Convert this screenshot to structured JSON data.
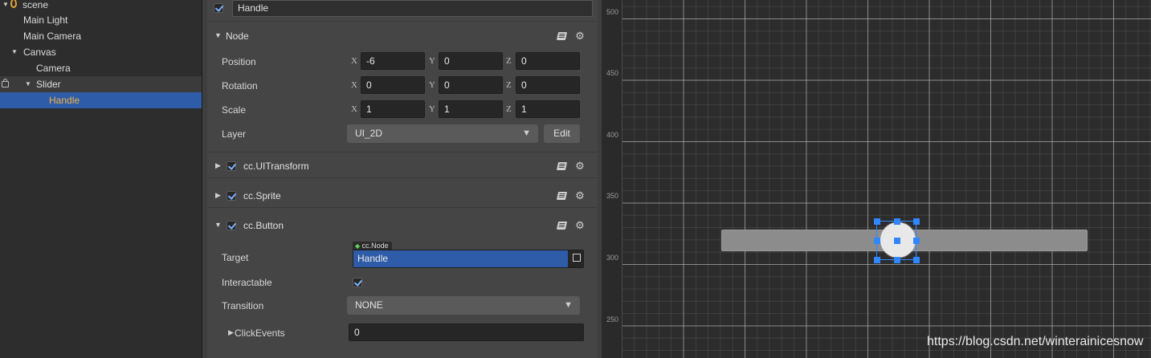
{
  "hierarchy": {
    "items": [
      {
        "label": "scene",
        "depth": 0,
        "expanded": true
      },
      {
        "label": "Main Light",
        "depth": 1
      },
      {
        "label": "Main Camera",
        "depth": 1
      },
      {
        "label": "Canvas",
        "depth": 1,
        "expanded": true
      },
      {
        "label": "Camera",
        "depth": 2
      },
      {
        "label": "Slider",
        "depth": 2,
        "expanded": true,
        "locked": true
      },
      {
        "label": "Handle",
        "depth": 3,
        "selected": true
      }
    ]
  },
  "inspector": {
    "node_name": "Handle",
    "node_enabled": true,
    "node_section": {
      "title": "Node",
      "position": {
        "label": "Position",
        "x": "-6",
        "y": "0",
        "z": "0"
      },
      "rotation": {
        "label": "Rotation",
        "x": "0",
        "y": "0",
        "z": "0"
      },
      "scale": {
        "label": "Scale",
        "x": "1",
        "y": "1",
        "z": "1"
      },
      "layer": {
        "label": "Layer",
        "value": "UI_2D",
        "edit_label": "Edit"
      },
      "axis_x": "X",
      "axis_y": "Y",
      "axis_z": "Z"
    },
    "components": [
      {
        "title": "cc.UITransform",
        "enabled": true,
        "expanded": false
      },
      {
        "title": "cc.Sprite",
        "enabled": true,
        "expanded": false
      },
      {
        "title": "cc.Button",
        "enabled": true,
        "expanded": true
      }
    ],
    "button": {
      "target_label": "Target",
      "target_type_badge": "cc.Node",
      "target_value": "Handle",
      "interactable_label": "Interactable",
      "interactable": true,
      "transition_label": "Transition",
      "transition_value": "NONE",
      "click_events_label": "ClickEvents",
      "click_events_count": "0"
    }
  },
  "scene": {
    "ruler_labels": [
      "500",
      "450",
      "400",
      "350",
      "300",
      "250"
    ]
  },
  "watermark": "https://blog.csdn.net/winterainicesnow",
  "colors": {
    "selection_blue": "#2f5ca8",
    "gizmo_blue": "#2f86ff",
    "selected_text": "#f0b34a",
    "check_blue": "#7fb2ff"
  }
}
